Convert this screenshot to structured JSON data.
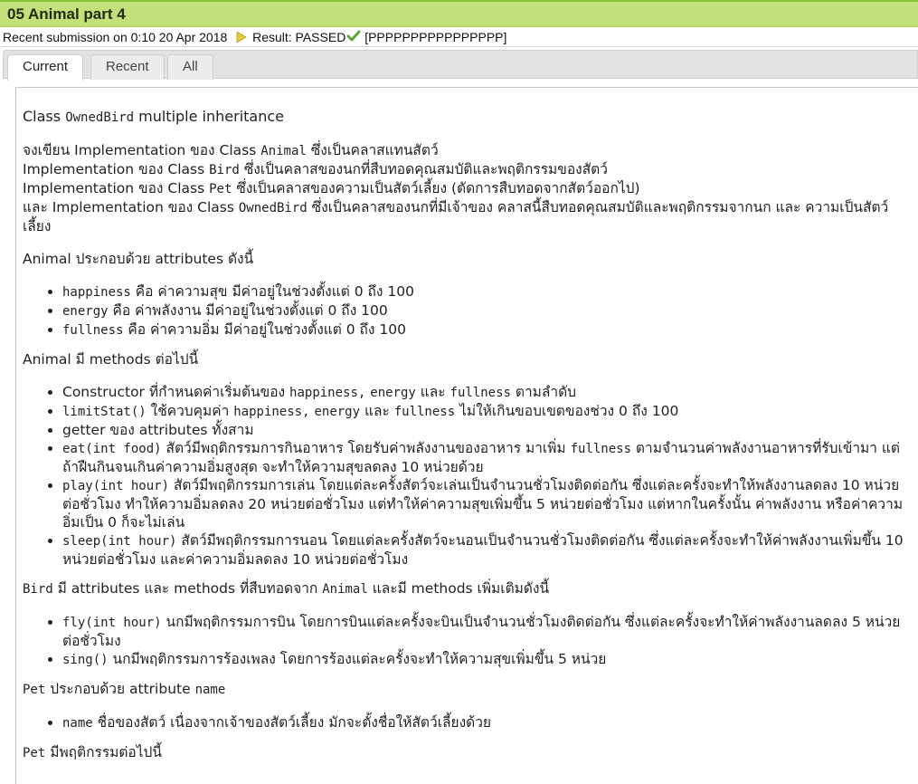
{
  "title": "05 Animal part 4",
  "submission": {
    "prefix": "Recent submission on",
    "datetime": "0:10 20 Apr 2018",
    "result_label": "Result:",
    "result": "PASSED",
    "result_string": "[PPPPPPPPPPPPPPPP]"
  },
  "tabs": [
    {
      "label": "Current"
    },
    {
      "label": "Recent"
    },
    {
      "label": "All"
    }
  ],
  "content": {
    "heading": {
      "a": "Class ",
      "code": "OwnedBird",
      "b": " multiple inheritance"
    },
    "intro": [
      {
        "a": "จงเขียน Implementation ของ Class ",
        "code": "Animal",
        "b": " ซึ่งเป็นคลาสแทนสัตว์"
      },
      {
        "a": "Implementation ของ Class ",
        "code": "Bird",
        "b": " ซึ่งเป็นคลาสของนกที่สืบทอดคุณสมบัติและพฤติกรรมของสัตว์"
      },
      {
        "a": "Implementation ของ Class ",
        "code": "Pet",
        "b": " ซึ่งเป็นคลาสของความเป็นสัตว์เลี้ยง (ตัดการสืบทอดจากสัตว์ออกไป)"
      },
      {
        "a": "และ Implementation ของ Class ",
        "code": "OwnedBird",
        "b": " ซึ่งเป็นคลาสของนกที่มีเจ้าของ คลาสนี้สืบทอดคุณสมบัติและพฤติกรรมจากนก และ ความเป็นสัตว์เลี้ยง"
      }
    ],
    "animal_attr_heading": "Animal ประกอบด้วย attributes ดังนี้",
    "animal_attrs": [
      {
        "code": "happiness",
        "text": " คือ ค่าความสุข มีค่าอยู่ในช่วงตั้งแต่ 0 ถึง 100"
      },
      {
        "code": "energy",
        "text": " คือ ค่าพลังงาน มีค่าอยู่ในช่วงตั้งแต่ 0 ถึง 100"
      },
      {
        "code": "fullness",
        "text": " คือ ค่าความอิ่ม มีค่าอยู่ในช่วงตั้งแต่ 0 ถึง 100"
      }
    ],
    "animal_methods_heading": "Animal มี methods ต่อไปนี้",
    "animal_methods": {
      "constructor": {
        "a": "Constructor ที่กำหนดค่าเริ่มต้นของ ",
        "c1": "happiness,",
        "b": " ",
        "c2": "energy",
        "c": " และ ",
        "c3": "fullness",
        "d": " ตามลำดับ"
      },
      "limitstat": {
        "c0": "limitStat()",
        "a": " ใช้ควบคุมค่า ",
        "c1": "happiness,",
        "b": " ",
        "c2": "energy",
        "c": " และ ",
        "c3": "fullness",
        "d": " ไม่ให้เกินขอบเขตของช่วง 0 ถึง 100"
      },
      "getter": "getter ของ attributes ทั้งสาม",
      "eat": {
        "c0": "eat(int food)",
        "a": " สัตว์มีพฤติกรรมการกินอาหาร โดยรับค่าพลังงานของอาหาร มาเพิ่ม ",
        "c1": "fullness",
        "b": " ตามจำนวนค่าพลังงานอาหารที่รับเข้ามา แต่ถ้าฝืนกินจนเกินค่าความอิ่มสูงสุด จะทำให้ความสุขลดลง 10 หน่วยด้วย"
      },
      "play": {
        "c0": "play(int hour)",
        "a": " สัตว์มีพฤติกรรมการเล่น โดยแต่ละครั้งสัตว์จะเล่นเป็นจำนวนชั่วโมงติดต่อกัน ซึ่งแต่ละครั้งจะทำให้พลังงานลดลง 10 หน่วยต่อชั่วโมง ทำให้ความอิ่มลดลง 20 หน่วยต่อชั่วโมง แต่ทำให้ค่าความสุขเพิ่มขึ้น 5 หน่วยต่อชั่วโมง แต่หากในครั้งนั้น ค่าพลังงาน หรือค่าความอิ่มเป็น 0 ก็จะไม่เล่น"
      },
      "sleep": {
        "c0": "sleep(int hour)",
        "a": " สัตว์มีพฤติกรรมการนอน โดยแต่ละครั้งสัตว์จะนอนเป็นจำนวนชั่วโมงติดต่อกัน ซึ่งแต่ละครั้งจะทำให้ค่าพลังงานเพิ่มขึ้น 10 หน่วยต่อชั่วโมง และค่าความอิ่มลดลง 10 หน่วยต่อชั่วโมง"
      }
    },
    "bird_heading": {
      "c0": "Bird",
      "a": " มี attributes และ methods ที่สืบทอดจาก ",
      "c1": "Animal",
      "b": " และมี methods เพิ่มเติมดังนี้"
    },
    "bird_methods": [
      {
        "code": "fly(int hour)",
        "text": " นกมีพฤติกรรมการบิน โดยการบินแต่ละครั้งจะบินเป็นจำนวนชั่วโมงติดต่อกัน ซึ่งแต่ละครั้งจะทำให้ค่าพลังงานลดลง 5 หน่วยต่อชั่วโมง"
      },
      {
        "code": "sing()",
        "text": " นกมีพฤติกรรมการร้องเพลง โดยการร้องแต่ละครั้งจะทำให้ความสุขเพิ่มขึ้น 5 หน่วย"
      }
    ],
    "pet_attr_heading": {
      "c0": "Pet",
      "a": " ประกอบด้วย attribute ",
      "c1": "name"
    },
    "pet_attrs": [
      {
        "code": "name",
        "text": " ชื่อของสัตว์ เนื่องจากเจ้าของสัตว์เลี้ยง มักจะตั้งชื่อให้สัตว์เลี้ยงด้วย"
      }
    ],
    "pet_behavior_heading": {
      "c0": "Pet",
      "a": " มีพฤติกรรมต่อไปนี้"
    }
  },
  "icons": {
    "flag": "flag-icon",
    "check": "check-icon"
  },
  "colors": {
    "title_bar": "#c3e07a",
    "title_border": "#8fc53c",
    "check_green": "#5aa83a",
    "flag_yellow": "#e8c93a"
  }
}
